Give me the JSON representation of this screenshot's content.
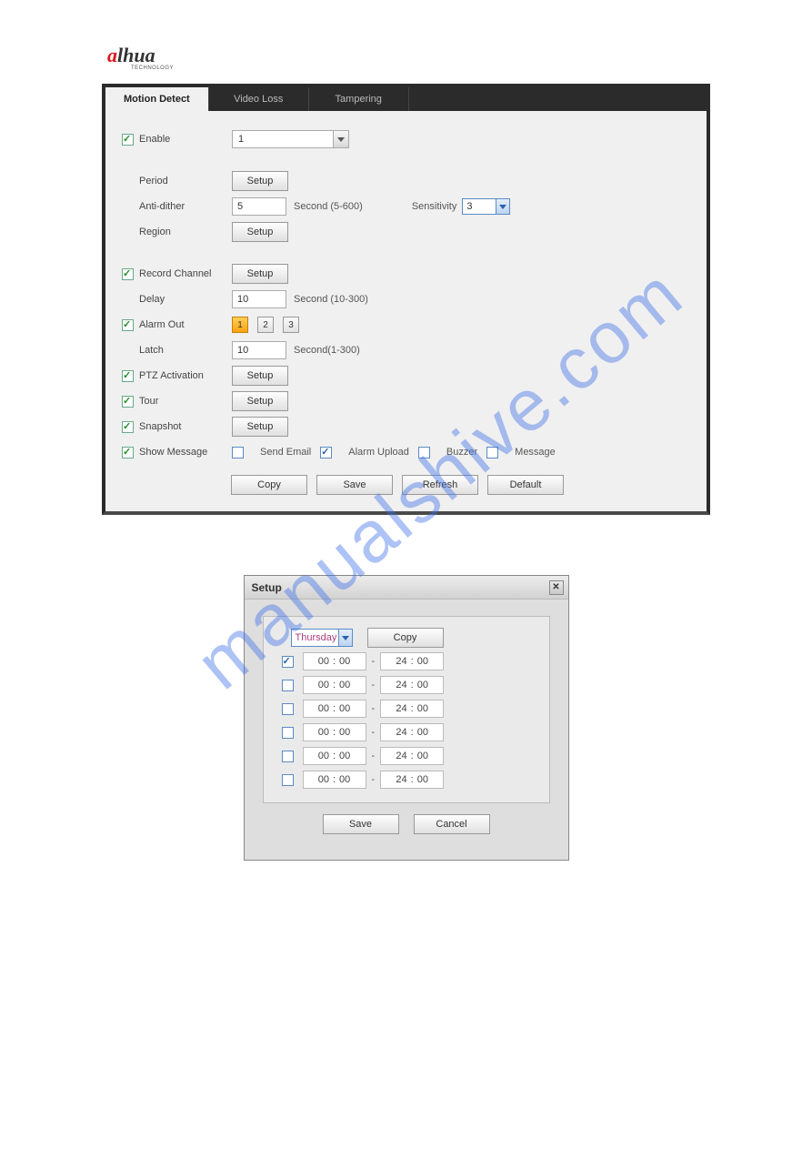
{
  "logo": {
    "a": "a",
    "lhua": "lhua",
    "sub": "TECHNOLOGY"
  },
  "watermark": "manualshive.com",
  "tabs": [
    "Motion Detect",
    "Video Loss",
    "Tampering"
  ],
  "main": {
    "enable_label": "Enable",
    "enable_checked": true,
    "channel_value": "1",
    "period_label": "Period",
    "setup_label": "Setup",
    "antidither_label": "Anti-dither",
    "antidither_value": "5",
    "antidither_hint": "Second (5-600)",
    "sensitivity_label": "Sensitivity",
    "sensitivity_value": "3",
    "region_label": "Region",
    "record_label": "Record Channel",
    "record_checked": true,
    "delay_label": "Delay",
    "delay_value": "10",
    "delay_hint": "Second (10-300)",
    "alarmout_label": "Alarm Out",
    "alarmout_checked": true,
    "alarmout_buttons": [
      "1",
      "2",
      "3"
    ],
    "latch_label": "Latch",
    "latch_value": "10",
    "latch_hint": "Second(1-300)",
    "ptz_label": "PTZ Activation",
    "ptz_checked": true,
    "tour_label": "Tour",
    "tour_checked": true,
    "snapshot_label": "Snapshot",
    "snapshot_checked": true,
    "showmsg_label": "Show Message",
    "showmsg_checked": true,
    "sendemail_label": "Send Email",
    "alarmupload_label": "Alarm Upload",
    "buzzer_label": "Buzzer",
    "message_label": "Message",
    "copy": "Copy",
    "save": "Save",
    "refresh": "Refresh",
    "default": "Default"
  },
  "popup": {
    "title": "Setup",
    "day": "Thursday",
    "copy": "Copy",
    "times": [
      {
        "checked": true,
        "start_h": "00",
        "start_m": "00",
        "end_h": "24",
        "end_m": "00"
      },
      {
        "checked": false,
        "start_h": "00",
        "start_m": "00",
        "end_h": "24",
        "end_m": "00"
      },
      {
        "checked": false,
        "start_h": "00",
        "start_m": "00",
        "end_h": "24",
        "end_m": "00"
      },
      {
        "checked": false,
        "start_h": "00",
        "start_m": "00",
        "end_h": "24",
        "end_m": "00"
      },
      {
        "checked": false,
        "start_h": "00",
        "start_m": "00",
        "end_h": "24",
        "end_m": "00"
      },
      {
        "checked": false,
        "start_h": "00",
        "start_m": "00",
        "end_h": "24",
        "end_m": "00"
      }
    ],
    "save": "Save",
    "cancel": "Cancel"
  }
}
